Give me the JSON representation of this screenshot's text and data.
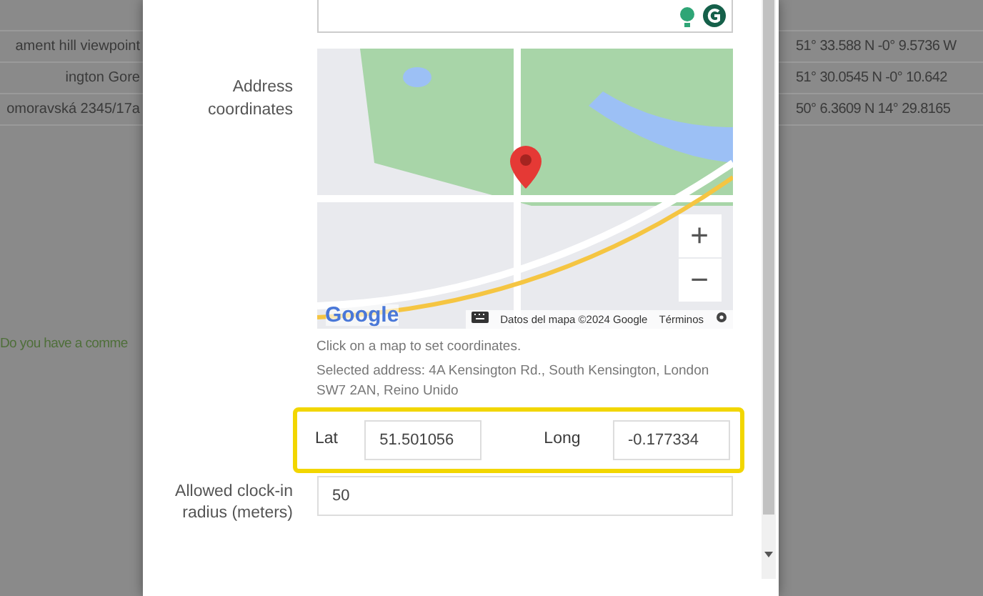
{
  "background_table": {
    "rows": [
      {
        "column_1": "ament hill viewpoint",
        "column_2": "51° 33.588 N -0° 9.5736 W"
      },
      {
        "column_1": "ington Gore",
        "column_2": "51° 30.0545 N -0° 10.642"
      },
      {
        "column_1": "omoravská 2345/17a",
        "column_2": "50° 6.3609 N 14° 29.8165"
      }
    ],
    "comment_prompt": "Do you have a comme"
  },
  "dialog": {
    "address_coordinates": {
      "label": "Address coordinates",
      "map": {
        "zoom_in": "+",
        "zoom_out": "−",
        "logo": "Google",
        "attribution": "Datos del mapa ©2024 Google",
        "terms": "Términos"
      },
      "hint": "Click on a map to set coordinates.",
      "selected_address": "Selected address: 4A Kensington Rd., South Kensington, London SW7 2AN, Reino Unido",
      "lat": {
        "label": "Lat",
        "value": "51.501056"
      },
      "long": {
        "label": "Long",
        "value": "-0.177334"
      },
      "highlighted": true
    },
    "radius": {
      "label": "Allowed clock-in radius (meters)",
      "value": "50"
    }
  }
}
